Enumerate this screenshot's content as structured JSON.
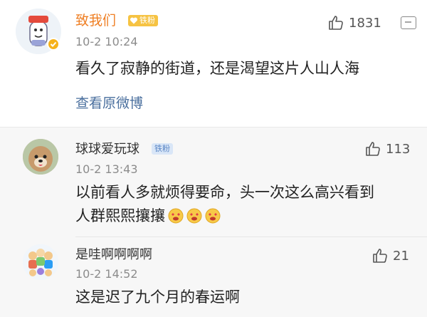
{
  "main_comment": {
    "username": "致我们",
    "badge": "铁粉",
    "time": "10-2 10:24",
    "likes": "1831",
    "content": "看久了寂静的街道，还是渴望这片人山人海",
    "view_original": "查看原微博"
  },
  "replies": [
    {
      "username": "球球爱玩球",
      "badge": "铁粉",
      "time": "10-2 13:43",
      "likes": "113",
      "content_line1": "以前看人多就烦得要命，头一次这么高兴看到",
      "content_line2": "人群熙熙攘攘",
      "emojis": [
        "heart-eyes-emoji",
        "heart-eyes-emoji",
        "heart-eyes-emoji"
      ]
    },
    {
      "username": "是哇啊啊啊啊",
      "time": "10-2 14:52",
      "likes": "21",
      "content": "这是迟了九个月的春运啊"
    }
  ],
  "colors": {
    "username_vip": "#ef7f24",
    "link": "#4a6f9e",
    "time": "#8c8c8c",
    "reply_bg": "#f7f7f7"
  }
}
